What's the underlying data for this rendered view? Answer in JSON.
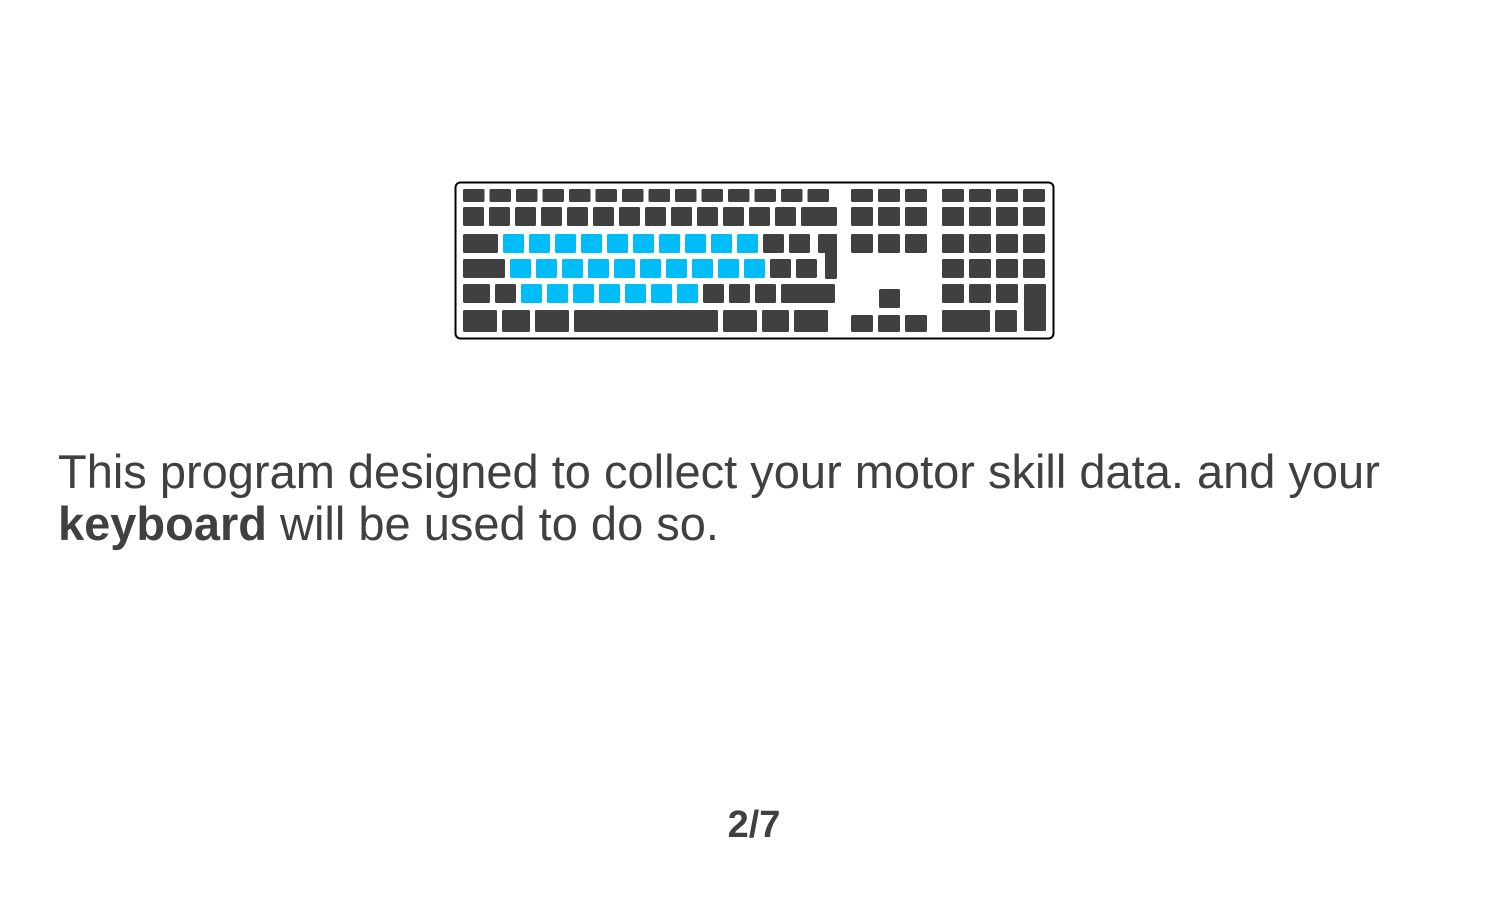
{
  "instruction": {
    "part1": "This program designed to collect your motor skill data. and your ",
    "emphasis": "keyboard",
    "part2": " will  be used to do so."
  },
  "page": {
    "indicator": "2/7"
  },
  "colors": {
    "key_default": "#404040",
    "key_highlight": "#00bdf7",
    "keyboard_outline": "#000000",
    "text": "#404040"
  },
  "icons": {
    "keyboard": "keyboard-illustration-icon"
  }
}
